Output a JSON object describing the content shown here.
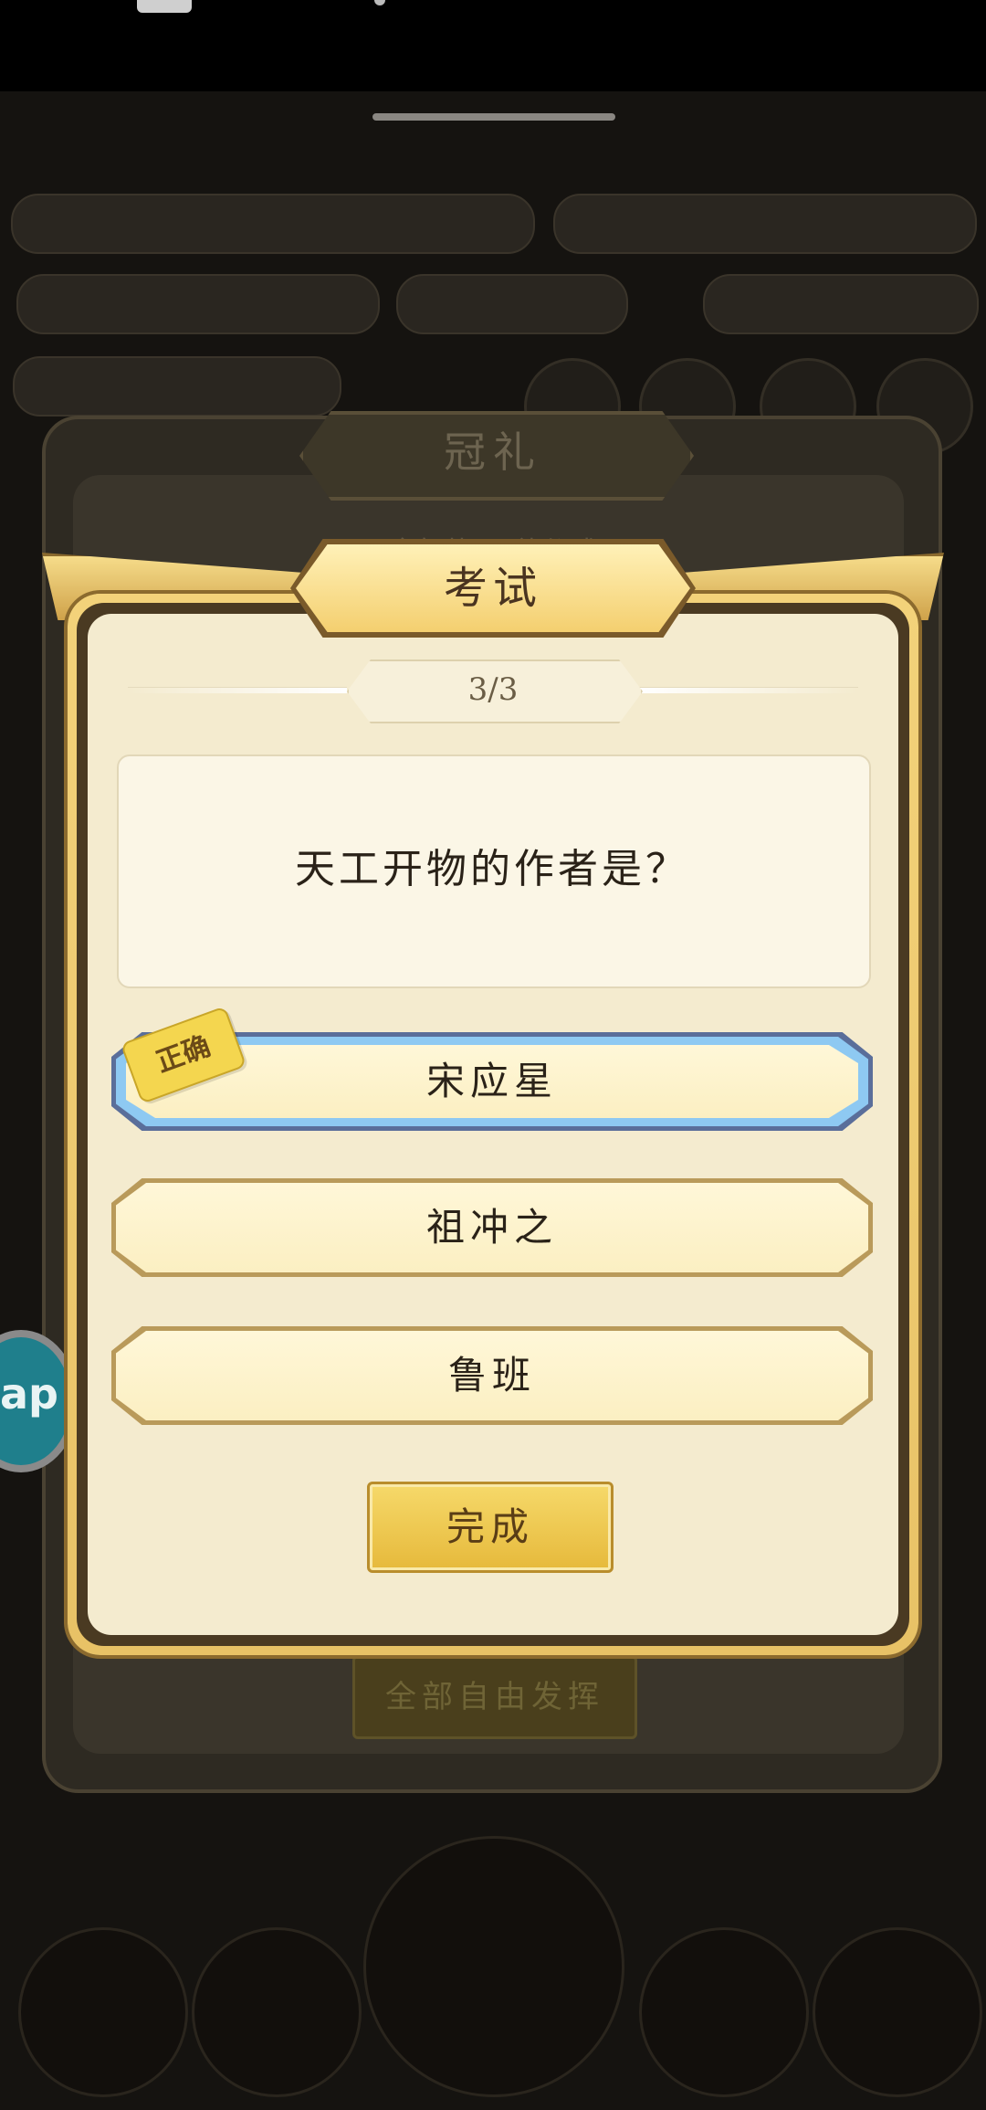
{
  "background": {
    "panel_title": "冠礼",
    "panel_subtitle": "今年共 … 礼仪式",
    "free_button_label": "全部自由发挥",
    "side_badge_text": "ap"
  },
  "modal": {
    "title": "考试",
    "progress": "3/3",
    "question": "天工开物的作者是？",
    "options": [
      {
        "label": "宋应星",
        "selected": true
      },
      {
        "label": "祖冲之",
        "selected": false
      },
      {
        "label": "鲁班",
        "selected": false
      }
    ],
    "correct_tag": "正确",
    "done_label": "完成"
  },
  "colors": {
    "accent_gold": "#f3d27a",
    "selected_blue": "#8ec9f2",
    "modal_bg": "#f4ebcf",
    "dim_background": "#151310"
  }
}
